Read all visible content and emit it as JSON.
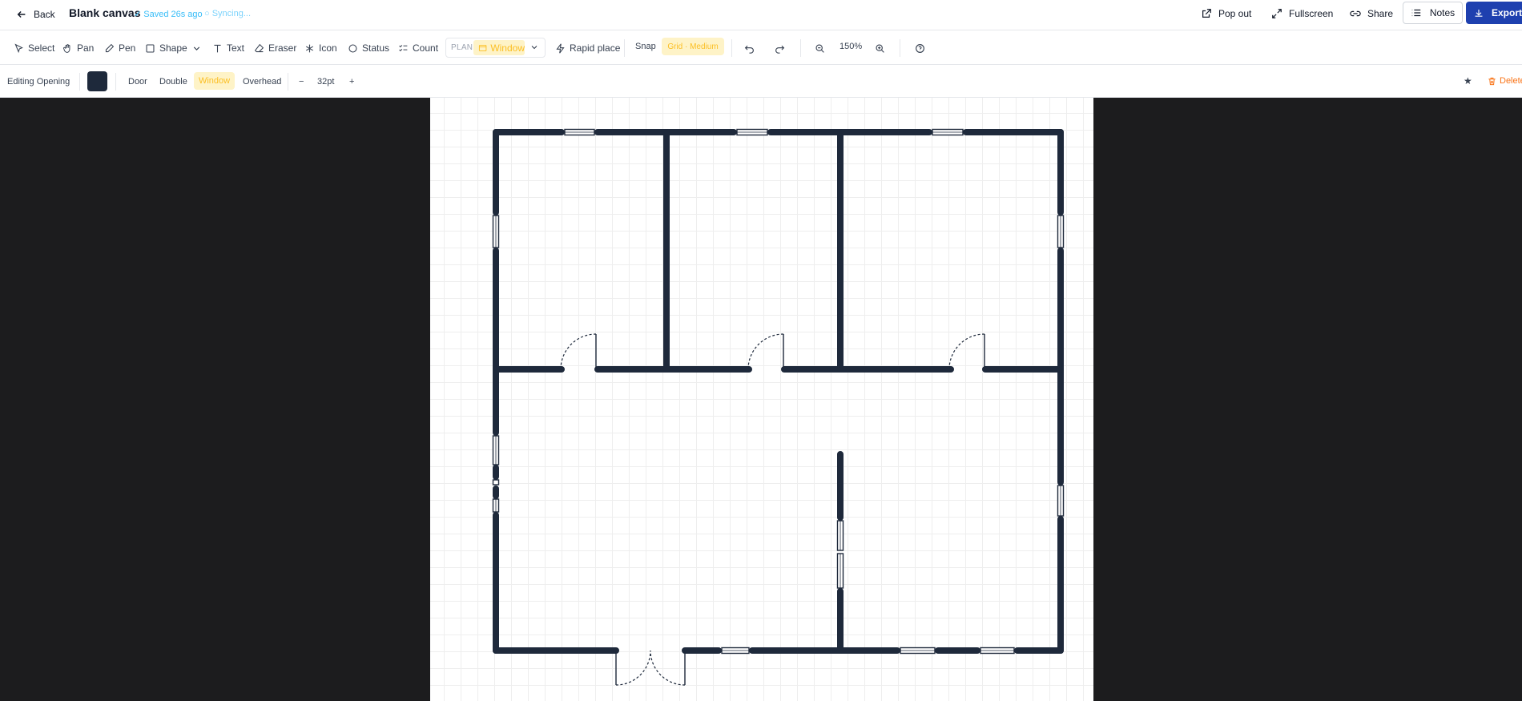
{
  "header": {
    "back_label": "Back",
    "title": "Blank canvas",
    "saved_status": "✓ Saved 26s ago",
    "sync_status": "○ Syncing...",
    "popout_label": "Pop out",
    "fullscreen_label": "Fullscreen",
    "share_label": "Share",
    "notes_label": "Notes",
    "export_label": "Export"
  },
  "toolbar": {
    "select": "Select",
    "pan": "Pan",
    "pen": "Pen",
    "shape": "Shape",
    "text": "Text",
    "eraser": "Eraser",
    "icon": "Icon",
    "status": "Status",
    "count": "Count",
    "plan_label": "PLAN",
    "plan_selected": "Window",
    "rapid_place": "Rapid place",
    "snap": "Snap",
    "grid": "Grid · Medium",
    "zoom": "150%"
  },
  "props": {
    "editing_label": "Editing Opening",
    "color": "#1e293b",
    "door": "Door",
    "double": "Double",
    "window": "Window",
    "overhead": "Overhead",
    "minus": "−",
    "size": "32pt",
    "plus": "+",
    "star": "★",
    "delete": "Delete"
  },
  "colors": {
    "accent": "#1e40af",
    "highlight_bg": "#fef3c7",
    "highlight_text": "#fbbf24",
    "wall": "#1e293b",
    "sync": "#38bdf8",
    "delete": "#f97316"
  },
  "icons": [
    "arrow-left-icon",
    "external-link-icon",
    "expand-icon",
    "link-icon",
    "list-icon",
    "download-icon",
    "cursor-icon",
    "hand-icon",
    "pen-icon",
    "square-icon",
    "chevron-down-icon",
    "text-icon",
    "eraser-icon",
    "asterisk-icon",
    "circle-icon",
    "list-check-icon",
    "window-icon",
    "zap-icon",
    "undo-icon",
    "redo-icon",
    "zoom-out-icon",
    "zoom-in-icon",
    "help-icon",
    "trash-icon"
  ]
}
